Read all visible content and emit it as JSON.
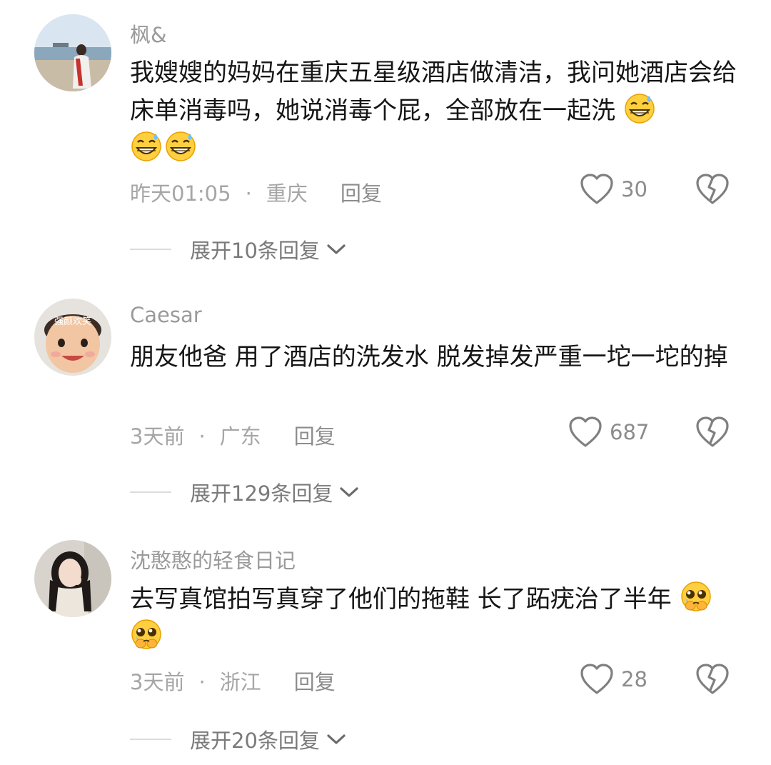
{
  "comments": [
    {
      "username": "枫&",
      "text": "我嫂嫂的妈妈在重庆五星级酒店做清洁，我问她酒店会给床单消毒吗，她说消毒个屁，全部放在一起洗",
      "emoji": "grinning-sweat-emoji",
      "emoji_count": 3,
      "time": "昨天01:05",
      "location": "重庆",
      "reply_label": "回复",
      "likes": "30",
      "expand_label": "展开10条回复"
    },
    {
      "username": "Caesar",
      "avatar_text": "强颜欢笑",
      "text": "朋友他爸 用了酒店的洗发水 脱发掉发严重一坨一坨的掉",
      "time": "3天前",
      "location": "广东",
      "reply_label": "回复",
      "likes": "687",
      "expand_label": "展开129条回复"
    },
    {
      "username": "沈憨憨的轻食日记",
      "text": "去写真馆拍写真穿了他们的拖鞋 长了跖疣治了半年",
      "emoji": "pleading-face-emoji",
      "emoji_count": 2,
      "time": "3天前",
      "location": "浙江",
      "reply_label": "回复",
      "likes": "28",
      "expand_label": "展开20条回复"
    }
  ],
  "separator": "·",
  "icons": {
    "like": "heart-outline-icon",
    "dislike": "broken-heart-icon",
    "expand": "chevron-down-icon"
  },
  "colors": {
    "username": "#9a9a9a",
    "text": "#161616",
    "meta": "#a6a6a6",
    "icon_stroke": "#7f7f7f",
    "divider": "#dcdcdc"
  }
}
